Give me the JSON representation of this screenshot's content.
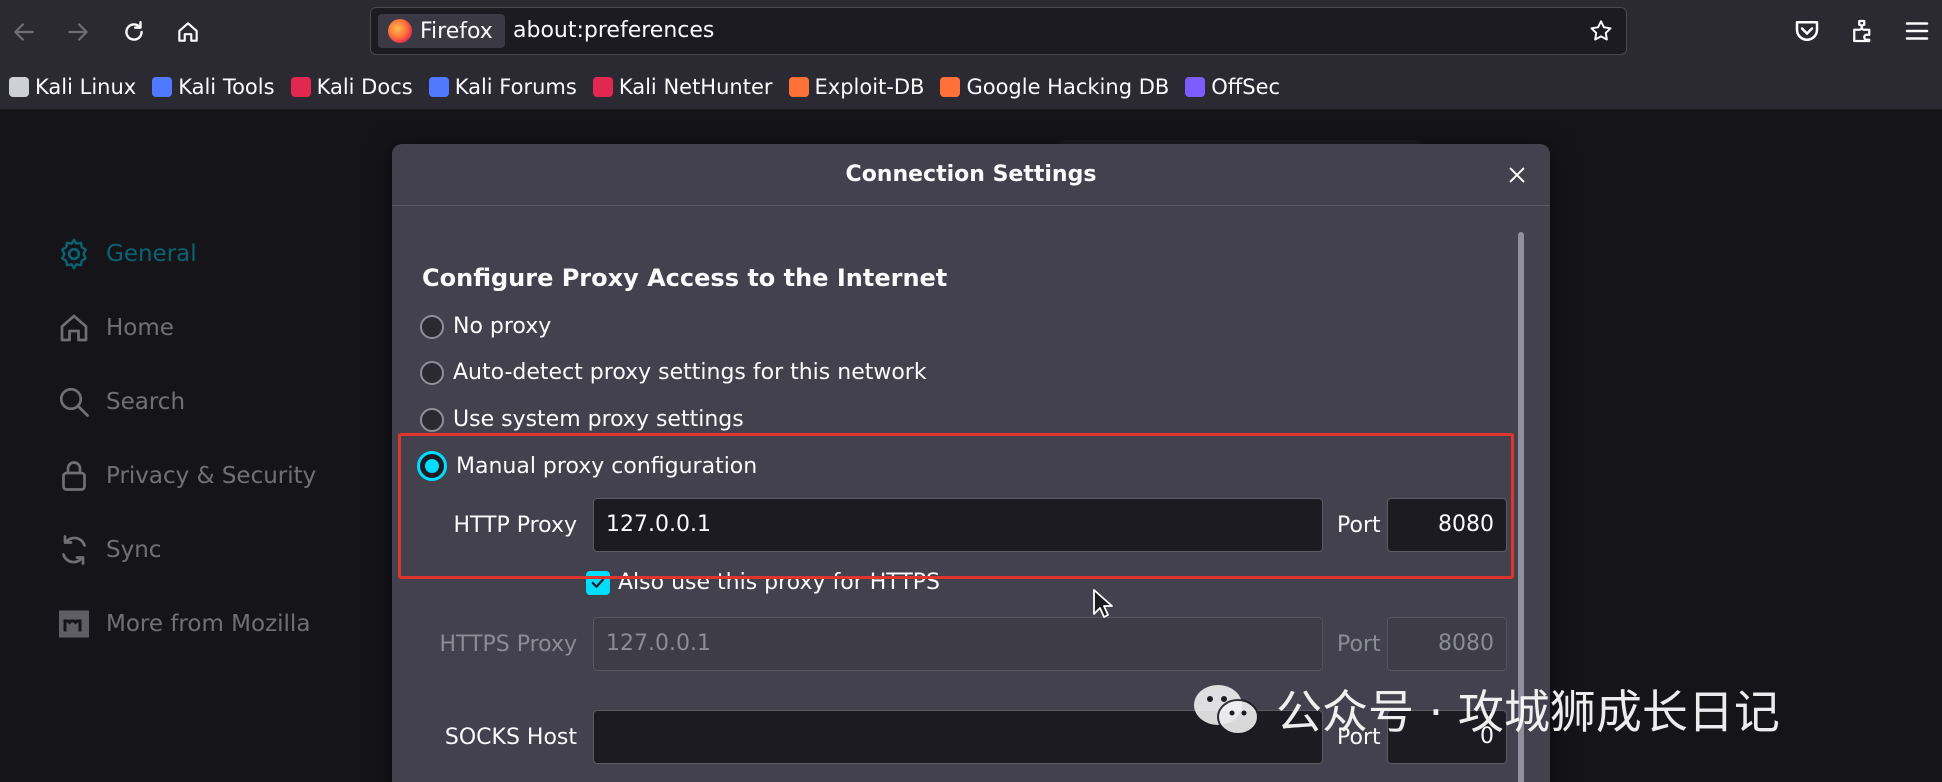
{
  "browser": {
    "identity_label": "Firefox",
    "url": "about:preferences"
  },
  "bookmarks": [
    {
      "label": "Kali Linux",
      "color": "#cfcfd8"
    },
    {
      "label": "Kali Tools",
      "color": "#4f79ff"
    },
    {
      "label": "Kali Docs",
      "color": "#e22850"
    },
    {
      "label": "Kali Forums",
      "color": "#4f79ff"
    },
    {
      "label": "Kali NetHunter",
      "color": "#e22850"
    },
    {
      "label": "Exploit-DB",
      "color": "#ff7139"
    },
    {
      "label": "Google Hacking DB",
      "color": "#ff7139"
    },
    {
      "label": "OffSec",
      "color": "#7d5cff"
    }
  ],
  "prefs_nav": {
    "items": [
      {
        "label": "General",
        "icon": "gear-icon",
        "selected": true
      },
      {
        "label": "Home",
        "icon": "home-icon"
      },
      {
        "label": "Search",
        "icon": "search-icon"
      },
      {
        "label": "Privacy & Security",
        "icon": "lock-icon"
      },
      {
        "label": "Sync",
        "icon": "sync-icon"
      },
      {
        "label": "More from Mozilla",
        "icon": "mozilla-icon"
      }
    ]
  },
  "dialog": {
    "title": "Connection Settings",
    "section_title": "Configure Proxy Access to the Internet",
    "options": [
      {
        "label": "No proxy",
        "selected": false
      },
      {
        "label": "Auto-detect proxy settings for this network",
        "selected": false
      },
      {
        "label": "Use system proxy settings",
        "selected": false
      },
      {
        "label": "Manual proxy configuration",
        "selected": true
      }
    ],
    "http_proxy": {
      "label": "HTTP Proxy",
      "value": "127.0.0.1",
      "port_label": "Port",
      "port": "8080"
    },
    "use_for_https": {
      "label": "Also use this proxy for HTTPS",
      "checked": true
    },
    "https_proxy": {
      "label": "HTTPS Proxy",
      "value": "127.0.0.1",
      "port_label": "Port",
      "port": "8080"
    },
    "socks_host": {
      "label": "SOCKS Host",
      "value": "",
      "port_label": "Port",
      "port": "0"
    }
  },
  "watermark": {
    "text": "公众号 · 攻城狮成长日记"
  },
  "colors": {
    "accent": "#00ddff",
    "highlight": "#e0342c"
  }
}
